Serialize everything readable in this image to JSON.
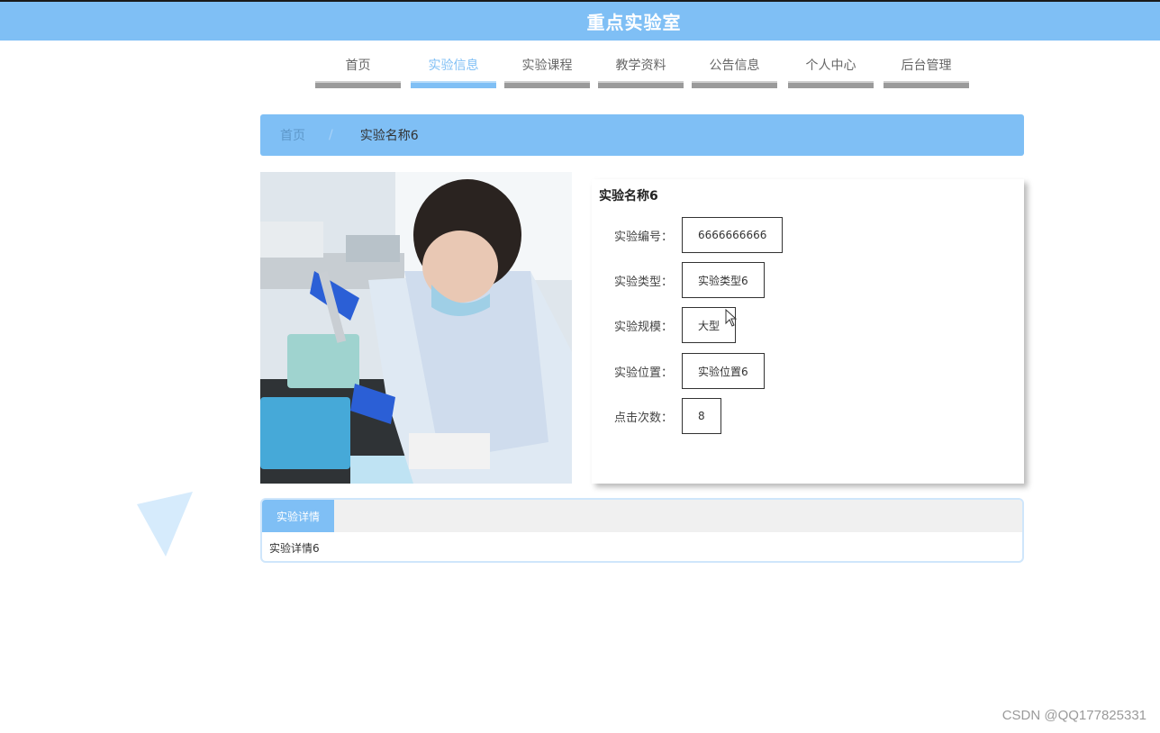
{
  "header": {
    "title": "重点实验室"
  },
  "nav": {
    "items": [
      {
        "label": "首页",
        "active": false
      },
      {
        "label": "实验信息",
        "active": true
      },
      {
        "label": "实验课程",
        "active": false
      },
      {
        "label": "教学资料",
        "active": false
      },
      {
        "label": "公告信息",
        "active": false
      },
      {
        "label": "个人中心",
        "active": false
      },
      {
        "label": "后台管理",
        "active": false
      }
    ]
  },
  "breadcrumb": {
    "home": "首页",
    "separator": "/",
    "current": "实验名称6"
  },
  "detail": {
    "name": "实验名称6",
    "fields": [
      {
        "label": "实验编号：",
        "value": "6666666666"
      },
      {
        "label": "实验类型：",
        "value": "实验类型6"
      },
      {
        "label": "实验规模：",
        "value": "大型"
      },
      {
        "label": "实验位置：",
        "value": "实验位置6"
      },
      {
        "label": "点击次数：",
        "value": "8"
      }
    ]
  },
  "tabs": {
    "items": [
      {
        "label": "实验详情",
        "active": true
      }
    ],
    "content": "实验详情6"
  },
  "watermark": "CSDN @QQ177825331",
  "colors": {
    "accent": "#7fbff5",
    "nav_inactive_bar": "#9a9a9a"
  }
}
